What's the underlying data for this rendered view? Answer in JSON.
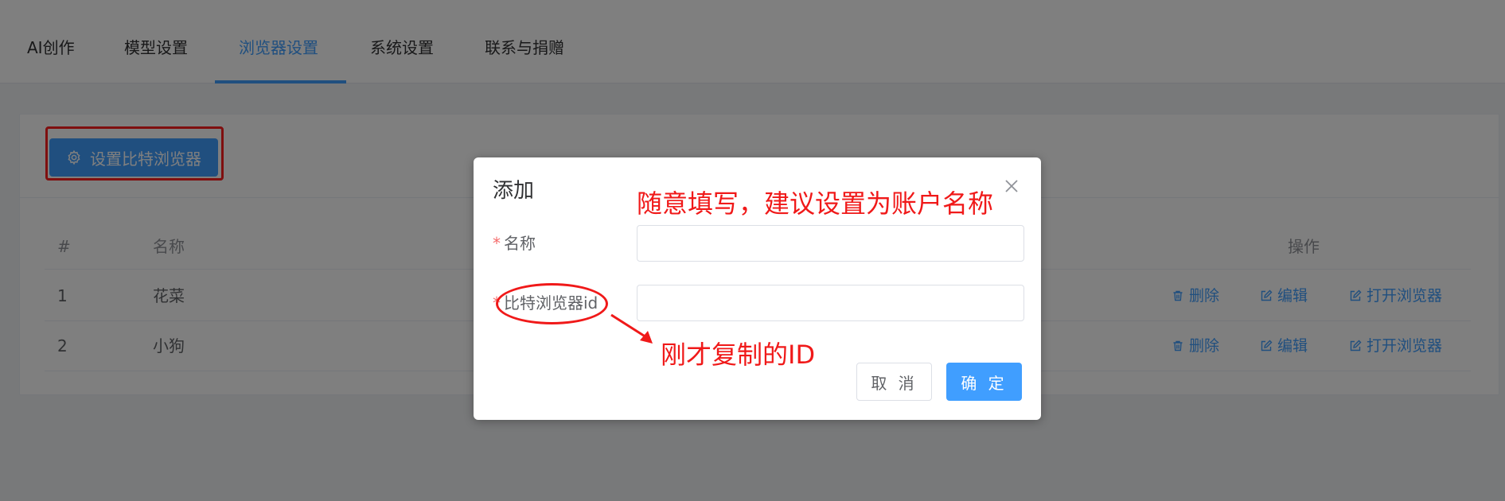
{
  "tabs": [
    {
      "label": "AI创作"
    },
    {
      "label": "模型设置"
    },
    {
      "label": "浏览器设置"
    },
    {
      "label": "系统设置"
    },
    {
      "label": "联系与捐赠"
    }
  ],
  "active_tab": "浏览器设置",
  "toolbar": {
    "setup_button_label": "设置比特浏览器"
  },
  "table": {
    "headers": {
      "index": "#",
      "name": "名称",
      "actions": "操作"
    },
    "rows": [
      {
        "index": "1",
        "name": "花菜"
      },
      {
        "index": "2",
        "name": "小狗"
      }
    ],
    "actions": {
      "delete": "删除",
      "edit": "编辑",
      "open": "打开浏览器"
    }
  },
  "dialog": {
    "title": "添加",
    "required_mark": "*",
    "name_label": "名称",
    "name_value": "",
    "id_label": "比特浏览器id",
    "id_value": "",
    "cancel_label": "取 消",
    "ok_label": "确 定"
  },
  "annotations": {
    "top_note": "随意填写，建议设置为账户名称",
    "bottom_note": "刚才复制的ID"
  },
  "colors": {
    "primary": "#409eff",
    "annotation": "#f01919",
    "required": "#f56c6c"
  }
}
